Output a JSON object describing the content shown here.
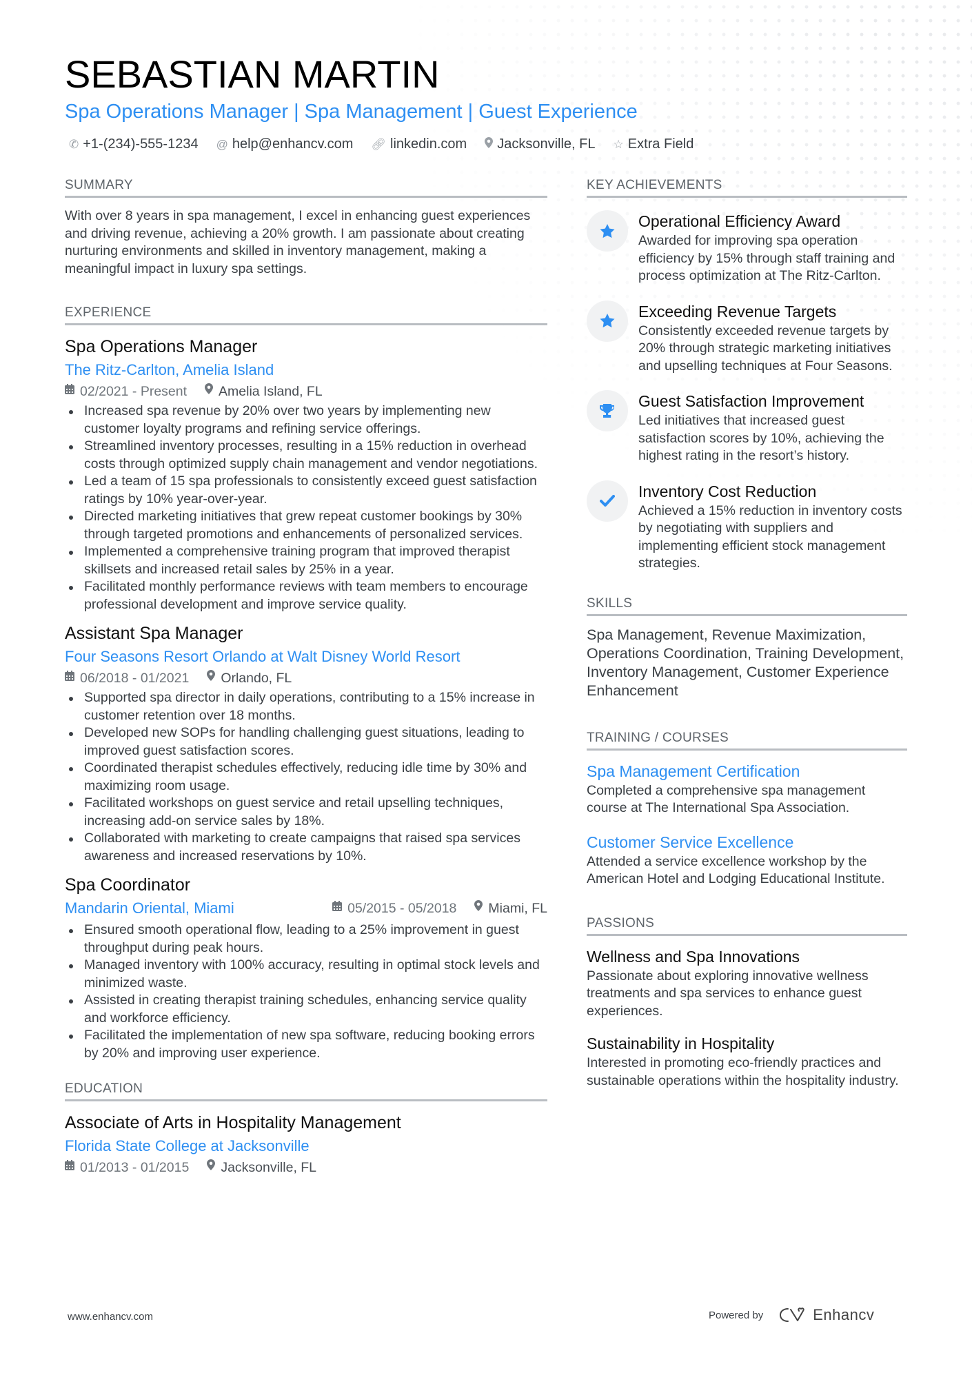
{
  "header": {
    "name": "SEBASTIAN MARTIN",
    "headline": "Spa Operations Manager | Spa Management | Guest Experience",
    "contacts": [
      {
        "icon": "phone-icon",
        "text": "+1-(234)-555-1234"
      },
      {
        "icon": "at-icon",
        "text": "help@enhancv.com"
      },
      {
        "icon": "link-icon",
        "text": "linkedin.com"
      },
      {
        "icon": "location-icon",
        "text": "Jacksonville, FL"
      },
      {
        "icon": "star-outline-icon",
        "text": "Extra Field"
      }
    ]
  },
  "summary": {
    "title": "SUMMARY",
    "text": "With over 8 years in spa management, I excel in enhancing guest experiences and driving revenue, achieving a 20% growth. I am passionate about creating nurturing environments and skilled in inventory management, making a meaningful impact in luxury spa settings."
  },
  "experience": {
    "title": "EXPERIENCE",
    "jobs": [
      {
        "title": "Spa Operations Manager",
        "company": "The Ritz-Carlton, Amelia Island",
        "dates": "02/2021 - Present",
        "location": "Amelia Island, FL",
        "bullets": [
          "Increased spa revenue by 20% over two years by implementing new customer loyalty programs and refining service offerings.",
          "Streamlined inventory processes, resulting in a 15% reduction in overhead costs through optimized supply chain management and vendor negotiations.",
          "Led a team of 15 spa professionals to consistently exceed guest satisfaction ratings by 10% year-over-year.",
          "Directed marketing initiatives that grew repeat customer bookings by 30% through targeted promotions and enhancements of personalized services.",
          "Implemented a comprehensive training program that improved therapist skillsets and increased retail sales by 25% in a year.",
          "Facilitated monthly performance reviews with team members to encourage professional development and improve service quality."
        ]
      },
      {
        "title": "Assistant Spa Manager",
        "company": "Four Seasons Resort Orlando at Walt Disney World Resort",
        "dates": "06/2018 - 01/2021",
        "location": "Orlando, FL",
        "bullets": [
          "Supported spa director in daily operations, contributing to a 15% increase in customer retention over 18 months.",
          "Developed new SOPs for handling challenging guest situations, leading to improved guest satisfaction scores.",
          "Coordinated therapist schedules effectively, reducing idle time by 30% and maximizing room usage.",
          "Facilitated workshops on guest service and retail upselling techniques, increasing add-on service sales by 18%.",
          "Collaborated with marketing to create campaigns that raised spa services awareness and increased reservations by 10%."
        ]
      },
      {
        "title": "Spa Coordinator",
        "company": "Mandarin Oriental, Miami",
        "dates": "05/2015 - 05/2018",
        "location": "Miami, FL",
        "bullets": [
          "Ensured smooth operational flow, leading to a 25% improvement in guest throughput during peak hours.",
          "Managed inventory with 100% accuracy, resulting in optimal stock levels and minimized waste.",
          "Assisted in creating therapist training schedules, enhancing service quality and workforce efficiency.",
          "Facilitated the implementation of new spa software, reducing booking errors by 20% and improving user experience."
        ]
      }
    ]
  },
  "education": {
    "title": "EDUCATION",
    "degree": "Associate of Arts in Hospitality Management",
    "school": "Florida State College at Jacksonville",
    "dates": "01/2013 - 01/2015",
    "location": "Jacksonville, FL"
  },
  "achievements": {
    "title": "KEY ACHIEVEMENTS",
    "items": [
      {
        "icon": "star-icon",
        "title": "Operational Efficiency Award",
        "desc": "Awarded for improving spa operation efficiency by 15% through staff training and process optimization at The Ritz-Carlton."
      },
      {
        "icon": "star-icon",
        "title": "Exceeding Revenue Targets",
        "desc": "Consistently exceeded revenue targets by 20% through strategic marketing initiatives and upselling techniques at Four Seasons."
      },
      {
        "icon": "trophy-icon",
        "title": "Guest Satisfaction Improvement",
        "desc": "Led initiatives that increased guest satisfaction scores by 10%, achieving the highest rating in the resort’s history."
      },
      {
        "icon": "checkmark-icon",
        "title": "Inventory Cost Reduction",
        "desc": "Achieved a 15% reduction in inventory costs by negotiating with suppliers and implementing efficient stock management strategies."
      }
    ]
  },
  "skills": {
    "title": "SKILLS",
    "text": "Spa Management, Revenue Maximization, Operations Coordination, Training Development, Inventory Management, Customer Experience Enhancement"
  },
  "training": {
    "title": "TRAINING / COURSES",
    "items": [
      {
        "title": "Spa Management Certification",
        "desc": "Completed a comprehensive spa management course at The International Spa Association."
      },
      {
        "title": "Customer Service Excellence",
        "desc": "Attended a service excellence workshop by the American Hotel and Lodging Educational Institute."
      }
    ]
  },
  "passions": {
    "title": "PASSIONS",
    "items": [
      {
        "title": "Wellness and Spa Innovations",
        "desc": "Passionate about exploring innovative wellness treatments and spa services to enhance guest experiences."
      },
      {
        "title": "Sustainability in Hospitality",
        "desc": "Interested in promoting eco-friendly practices and sustainable operations within the hospitality industry."
      }
    ]
  },
  "footer": {
    "website": "www.enhancv.com",
    "powered_by": "Powered by",
    "brand": "Enhancv"
  },
  "colors": {
    "accent": "#2e8ff2",
    "text": "#3a3f44",
    "heading": "#111111",
    "rule": "#b9bdc2",
    "icon_bg": "#f1f2f3"
  }
}
